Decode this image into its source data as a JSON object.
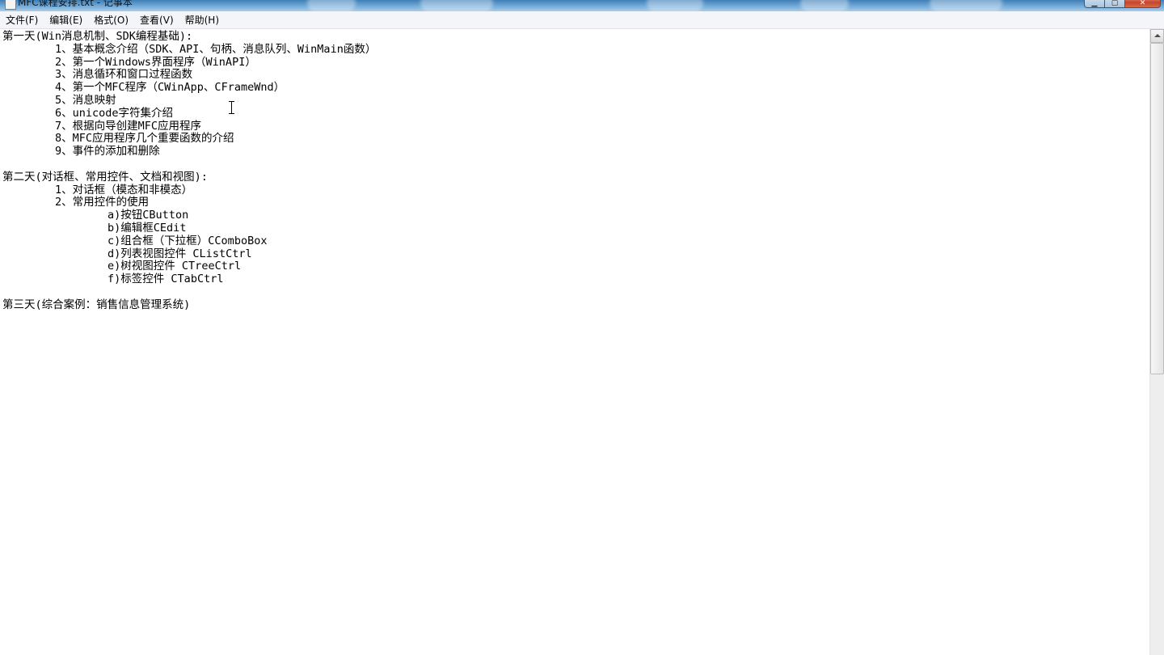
{
  "window": {
    "title": "MFC课程安排.txt - 记事本"
  },
  "menu": {
    "items": [
      "文件(F)",
      "编辑(E)",
      "格式(O)",
      "查看(V)",
      "帮助(H)"
    ]
  },
  "document": {
    "text": "第一天(Win消息机制、SDK编程基础):\n\t1、基本概念介绍（SDK、API、句柄、消息队列、WinMain函数）\n\t2、第一个Windows界面程序（WinAPI）\n\t3、消息循环和窗口过程函数\n\t4、第一个MFC程序（CWinApp、CFrameWnd）\n\t5、消息映射\n\t6、unicode字符集介绍\n\t7、根据向导创建MFC应用程序\n\t8、MFC应用程序几个重要函数的介绍\n\t9、事件的添加和删除\n\n第二天(对话框、常用控件、文档和视图):\n\t1、对话框（模态和非模态）\n\t2、常用控件的使用\n\t\ta)按钮CButton\n\t\tb)编辑框CEdit\n\t\tc)组合框（下拉框）CComboBox\n\t\td)列表视图控件 CListCtrl\n\t\te)树视图控件 CTreeCtrl\n\t\tf)标签控件 CTabCtrl\n\n第三天(综合案例：销售信息管理系统)"
  },
  "icons": {
    "app": "notepad-icon",
    "minimize": "minimize-icon",
    "maximize": "maximize-icon",
    "close": "close-icon",
    "cursor": "text-cursor-icon"
  }
}
